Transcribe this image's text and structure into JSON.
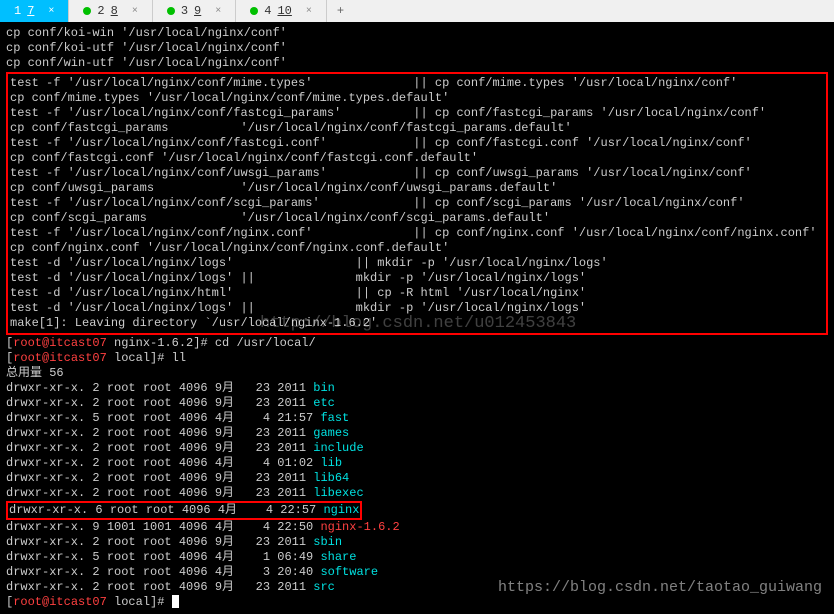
{
  "tabs": {
    "items": [
      {
        "num": "1",
        "label": "7",
        "active": true
      },
      {
        "num": "2",
        "label": "8",
        "active": false
      },
      {
        "num": "3",
        "label": "9",
        "active": false
      },
      {
        "num": "4",
        "label": "10",
        "active": false
      }
    ],
    "new_tab": "+"
  },
  "cp_lines": [
    "cp conf/koi-win '/usr/local/nginx/conf'",
    "cp conf/koi-utf '/usr/local/nginx/conf'",
    "cp conf/win-utf '/usr/local/nginx/conf'"
  ],
  "box_lines": [
    "test -f '/usr/local/nginx/conf/mime.types'              || cp conf/mime.types '/usr/local/nginx/conf'",
    "cp conf/mime.types '/usr/local/nginx/conf/mime.types.default'",
    "test -f '/usr/local/nginx/conf/fastcgi_params'          || cp conf/fastcgi_params '/usr/local/nginx/conf'",
    "cp conf/fastcgi_params          '/usr/local/nginx/conf/fastcgi_params.default'",
    "test -f '/usr/local/nginx/conf/fastcgi.conf'            || cp conf/fastcgi.conf '/usr/local/nginx/conf'",
    "cp conf/fastcgi.conf '/usr/local/nginx/conf/fastcgi.conf.default'",
    "test -f '/usr/local/nginx/conf/uwsgi_params'            || cp conf/uwsgi_params '/usr/local/nginx/conf'",
    "cp conf/uwsgi_params            '/usr/local/nginx/conf/uwsgi_params.default'",
    "test -f '/usr/local/nginx/conf/scgi_params'             || cp conf/scgi_params '/usr/local/nginx/conf'",
    "cp conf/scgi_params             '/usr/local/nginx/conf/scgi_params.default'",
    "test -f '/usr/local/nginx/conf/nginx.conf'              || cp conf/nginx.conf '/usr/local/nginx/conf/nginx.conf'",
    "cp conf/nginx.conf '/usr/local/nginx/conf/nginx.conf.default'",
    "test -d '/usr/local/nginx/logs'                 || mkdir -p '/usr/local/nginx/logs'",
    "test -d '/usr/local/nginx/logs' ||              mkdir -p '/usr/local/nginx/logs'",
    "test -d '/usr/local/nginx/html'                 || cp -R html '/usr/local/nginx'",
    "test -d '/usr/local/nginx/logs' ||              mkdir -p '/usr/local/nginx/logs'",
    "make[1]: Leaving directory `/usr/local/nginx-1.6.2'"
  ],
  "prompt1": {
    "user": "root@itcast07",
    "path": "nginx-1.6.2",
    "cmd": "cd /usr/local/"
  },
  "prompt2": {
    "user": "root@itcast07",
    "path": "local",
    "cmd": "ll"
  },
  "total": "总用量 56",
  "ls": [
    {
      "perm": "drwxr-xr-x. 2 root root 4096 9月   23 2011",
      "name": "bin"
    },
    {
      "perm": "drwxr-xr-x. 2 root root 4096 9月   23 2011",
      "name": "etc"
    },
    {
      "perm": "drwxr-xr-x. 5 root root 4096 4月    4 21:57",
      "name": "fast"
    },
    {
      "perm": "drwxr-xr-x. 2 root root 4096 9月   23 2011",
      "name": "games"
    },
    {
      "perm": "drwxr-xr-x. 2 root root 4096 9月   23 2011",
      "name": "include"
    },
    {
      "perm": "drwxr-xr-x. 2 root root 4096 4月    4 01:02",
      "name": "lib"
    },
    {
      "perm": "drwxr-xr-x. 2 root root 4096 9月   23 2011",
      "name": "lib64"
    },
    {
      "perm": "drwxr-xr-x. 2 root root 4096 9月   23 2011",
      "name": "libexec"
    },
    {
      "perm": "drwxr-xr-x. 6 root root 4096 4月    4 22:57",
      "name": "nginx",
      "boxed": true
    },
    {
      "perm": "drwxr-xr-x. 9 1001 1001 4096 4月    4 22:50",
      "name": "nginx-1.6.2",
      "red": true
    },
    {
      "perm": "drwxr-xr-x. 2 root root 4096 9月   23 2011",
      "name": "sbin"
    },
    {
      "perm": "drwxr-xr-x. 5 root root 4096 4月    1 06:49",
      "name": "share"
    },
    {
      "perm": "drwxr-xr-x. 2 root root 4096 4月    3 20:40",
      "name": "software"
    },
    {
      "perm": "drwxr-xr-x. 2 root root 4096 9月   23 2011",
      "name": "src"
    }
  ],
  "prompt3": {
    "user": "root@itcast07",
    "path": "local"
  },
  "watermark1": "http://blog.csdn.net/u012453843",
  "watermark2": "https://blog.csdn.net/taotao_guiwang"
}
